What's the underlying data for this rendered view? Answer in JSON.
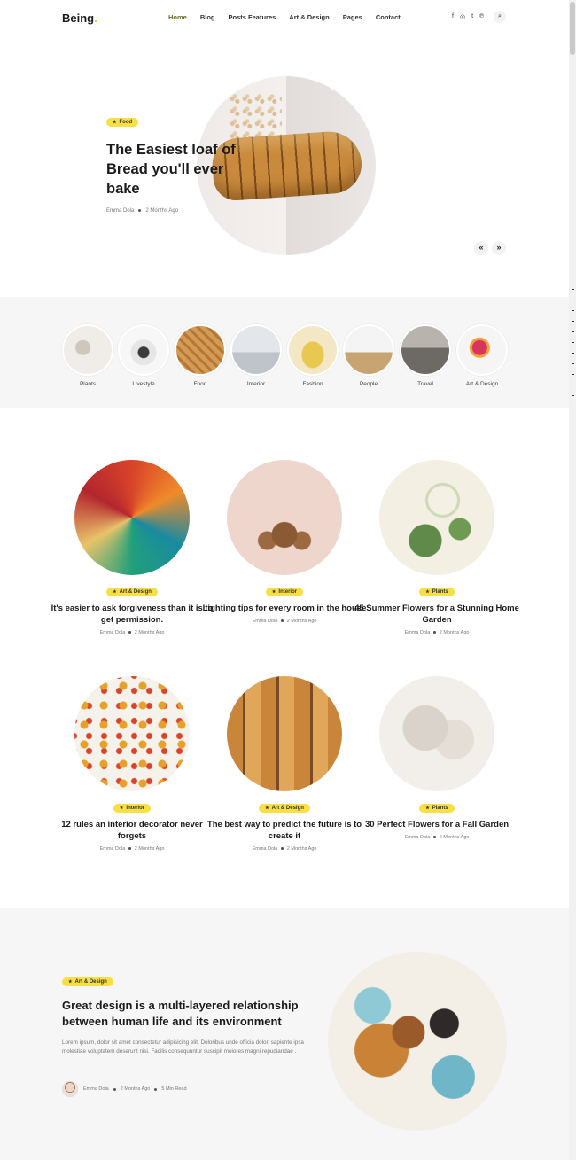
{
  "header": {
    "logo": "Being",
    "logo_dot": ".",
    "nav": [
      "Home",
      "Blog",
      "Posts Features",
      "Art & Design",
      "Pages",
      "Contact"
    ],
    "social_icons": [
      "facebook-icon",
      "instagram-icon",
      "twitter-icon",
      "pinterest-icon"
    ],
    "social_glyphs": [
      "f",
      "◎",
      "t",
      "℗"
    ],
    "search_glyph": "⌕"
  },
  "hero": {
    "badge": "Food",
    "title": "The Easiest loaf of Bread you'll ever bake",
    "author": "Emma Dola",
    "date": "2 Months Ago",
    "prev": "«",
    "next": "»"
  },
  "categories": [
    {
      "label": "Plants",
      "color": "#e9e4df"
    },
    {
      "label": "Livestyle",
      "color": "#d6d6d6"
    },
    {
      "label": "Food",
      "color": "#c98b4a"
    },
    {
      "label": "Interior",
      "color": "#cfd3d9"
    },
    {
      "label": "Fashion",
      "color": "#e9d49a"
    },
    {
      "label": "People",
      "color": "#caa774"
    },
    {
      "label": "Travel",
      "color": "#8f8c86"
    },
    {
      "label": "Art & Design",
      "color": "#d8355e"
    }
  ],
  "posts": [
    {
      "badge": "Art & Design",
      "title": "It's easier to ask forgiveness than it is to get permission.",
      "author": "Emma Dola",
      "date": "2 Months Ago"
    },
    {
      "badge": "Interior",
      "title": "Lighting tips for every room in the house",
      "author": "Emma Dola",
      "date": "2 Months Ago"
    },
    {
      "badge": "Plants",
      "title": "45 Summer Flowers for a Stunning Home Garden",
      "author": "Emma Dola",
      "date": "2 Months Ago"
    },
    {
      "badge": "Interior",
      "title": "12 rules an interior decorator never forgets",
      "author": "Emma Dola",
      "date": "2 Months Ago"
    },
    {
      "badge": "Art & Design",
      "title": "The best way to predict the future is to create it",
      "author": "Emma Dola",
      "date": "2 Months Ago"
    },
    {
      "badge": "Plants",
      "title": "30 Perfect Flowers for a Fall Garden",
      "author": "Emma Dola",
      "date": "2 Months Ago"
    }
  ],
  "featured": {
    "badge": "Art & Design",
    "title": "Great design is a multi-layered relationship between human life and its environment",
    "excerpt": "Lorem ipsum, dolor sit amet consectetur adipisicing elit. Doloribus unde officia dolor, sapiente ipsa molestiae voluptatem deserunt nisi. Facilis consequuntur suscipit moiores magni repudiandae .",
    "author": "Emma Dola",
    "date": "2 Months Ago",
    "read_time": "5 Min Read"
  },
  "colors": {
    "accent": "#f7df45",
    "band": "#f6f6f6",
    "nav_active": "#6f6a2a"
  }
}
